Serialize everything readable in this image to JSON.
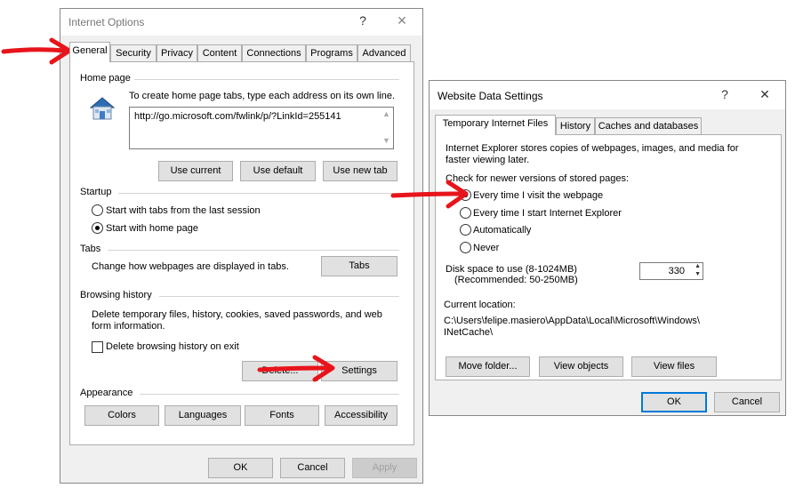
{
  "internet_options": {
    "title": "Internet Options",
    "help": "?",
    "close": "✕",
    "tabs": [
      "General",
      "Security",
      "Privacy",
      "Content",
      "Connections",
      "Programs",
      "Advanced"
    ],
    "home_page": {
      "label": "Home page",
      "description": "To create home page tabs, type each address on its own line.",
      "url": "http://go.microsoft.com/fwlink/p/?LinkId=255141",
      "buttons": [
        "Use current",
        "Use default",
        "Use new tab"
      ]
    },
    "startup": {
      "label": "Startup",
      "options": [
        "Start with tabs from the last session",
        "Start with home page"
      ],
      "selected": 1
    },
    "tabs_section": {
      "label": "Tabs",
      "description": "Change how webpages are displayed in tabs.",
      "button": "Tabs"
    },
    "browsing_history": {
      "label": "Browsing history",
      "description": "Delete temporary files, history, cookies, saved passwords, and web form information.",
      "checkbox_label": "Delete browsing history on exit",
      "delete_button": "Delete...",
      "settings_button": "Settings"
    },
    "appearance": {
      "label": "Appearance",
      "buttons": [
        "Colors",
        "Languages",
        "Fonts",
        "Accessibility"
      ]
    },
    "footer": {
      "ok": "OK",
      "cancel": "Cancel",
      "apply": "Apply"
    }
  },
  "website_data": {
    "title": "Website Data Settings",
    "help": "?",
    "close": "✕",
    "tabs": [
      "Temporary Internet Files",
      "History",
      "Caches and databases"
    ],
    "description": "Internet Explorer stores copies of webpages, images, and media for faster viewing later.",
    "check_label": "Check for newer versions of stored pages:",
    "options": [
      "Every time I visit the webpage",
      "Every time I start Internet Explorer",
      "Automatically",
      "Never"
    ],
    "selected": 0,
    "disk_label_1": "Disk space to use (8-1024MB)",
    "disk_label_2": "(Recommended: 50-250MB)",
    "disk_value": "330",
    "location_label": "Current location:",
    "location_path_1": "C:\\Users\\felipe.masiero\\AppData\\Local\\Microsoft\\Windows\\",
    "location_path_2": "INetCache\\",
    "buttons": [
      "Move folder...",
      "View objects",
      "View files"
    ],
    "footer": {
      "ok": "OK",
      "cancel": "Cancel"
    }
  },
  "colors": {
    "arrow": "#e8141b",
    "accent": "#0078d7"
  }
}
